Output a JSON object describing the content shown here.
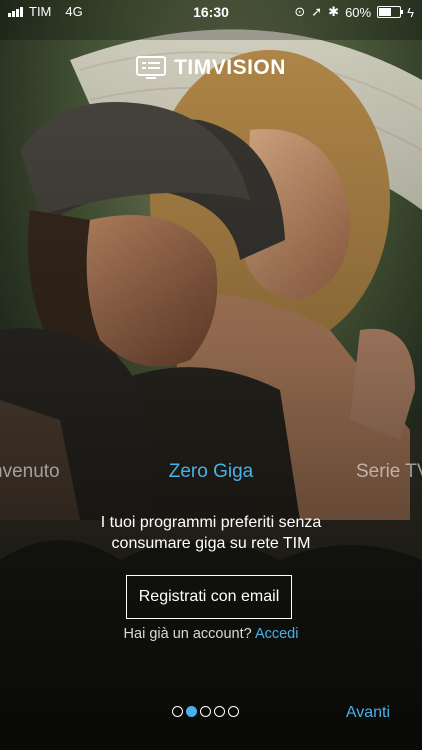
{
  "status_bar": {
    "carrier": "TIM",
    "network": "4G",
    "time": "16:30",
    "battery": "60%",
    "battery_level": 0.6
  },
  "brand": {
    "name": "TIMVISION",
    "accent": "#4ab0e8"
  },
  "carousel": {
    "previous_title": "nvenuto",
    "current_title": "Zero Giga",
    "next_title": "Serie TV",
    "description_line1": "I tuoi programmi preferiti senza",
    "description_line2": "consumare giga su rete TIM",
    "page_count": 5,
    "active_page": 2
  },
  "actions": {
    "register_label": "Registrati con email",
    "account_question": "Hai già un account?",
    "login_label": "Accedi",
    "next_label": "Avanti"
  }
}
